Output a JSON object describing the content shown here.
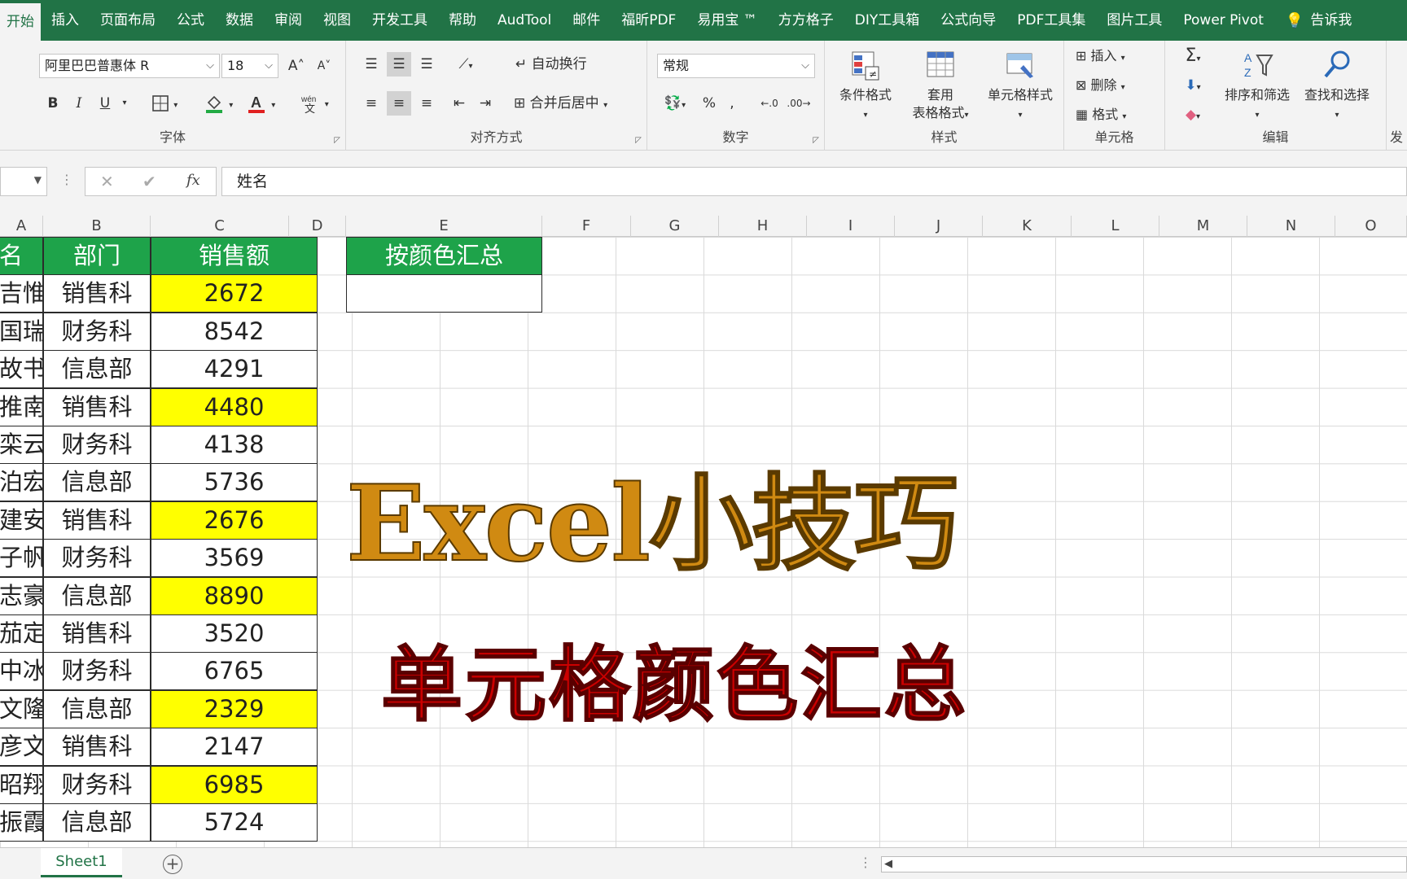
{
  "ribbon_tabs": [
    "开始",
    "插入",
    "页面布局",
    "公式",
    "数据",
    "审阅",
    "视图",
    "开发工具",
    "帮助",
    "AudTool",
    "邮件",
    "福昕PDF",
    "易用宝 ™",
    "方方格子",
    "DIY工具箱",
    "公式向导",
    "PDF工具集",
    "图片工具",
    "Power Pivot"
  ],
  "tell_me": "告诉我",
  "font": {
    "name": "阿里巴巴普惠体 R",
    "size": "18",
    "bold": "B",
    "italic": "I",
    "underline": "U",
    "grow": "A˄",
    "shrink": "A˅",
    "label": "字体"
  },
  "alignment": {
    "wrap": "自动换行",
    "merge": "合并后居中",
    "label": "对齐方式"
  },
  "number": {
    "format": "常规",
    "percent": "%",
    "comma": ",",
    "label": "数字"
  },
  "styles": {
    "conditional": "条件格式",
    "table_1": "套用",
    "table_2": "表格格式",
    "cell_styles": "单元格样式",
    "label": "样式"
  },
  "cells": {
    "insert": "插入",
    "delete": "删除",
    "format": "格式",
    "label": "单元格"
  },
  "editing": {
    "sort": "排序和筛选",
    "find": "查找和选择",
    "label": "编辑",
    "cut_label": "发"
  },
  "formula_bar": {
    "value": "姓名",
    "fx": "fx"
  },
  "columns": [
    "A",
    "B",
    "C",
    "D",
    "E",
    "F",
    "G",
    "H",
    "I",
    "J",
    "K",
    "L",
    "M",
    "N",
    "O"
  ],
  "table": {
    "headers": [
      "名",
      "部门",
      "销售额"
    ],
    "rows": [
      {
        "name": "吉惟",
        "dept": "销售科",
        "sales": "2672",
        "highlight": true
      },
      {
        "name": "国瑞",
        "dept": "财务科",
        "sales": "8542",
        "highlight": false
      },
      {
        "name": "故书",
        "dept": "信息部",
        "sales": "4291",
        "highlight": false
      },
      {
        "name": "推南",
        "dept": "销售科",
        "sales": "4480",
        "highlight": true
      },
      {
        "name": "栾云",
        "dept": "财务科",
        "sales": "4138",
        "highlight": false
      },
      {
        "name": "泊宏",
        "dept": "信息部",
        "sales": "5736",
        "highlight": false
      },
      {
        "name": "建安",
        "dept": "销售科",
        "sales": "2676",
        "highlight": true
      },
      {
        "name": "子帆",
        "dept": "财务科",
        "sales": "3569",
        "highlight": false
      },
      {
        "name": "志豪",
        "dept": "信息部",
        "sales": "8890",
        "highlight": true
      },
      {
        "name": "茄定",
        "dept": "销售科",
        "sales": "3520",
        "highlight": false
      },
      {
        "name": "中冰",
        "dept": "财务科",
        "sales": "6765",
        "highlight": false
      },
      {
        "name": "文隆",
        "dept": "信息部",
        "sales": "2329",
        "highlight": true
      },
      {
        "name": "彦文",
        "dept": "销售科",
        "sales": "2147",
        "highlight": false
      },
      {
        "name": "昭翔",
        "dept": "财务科",
        "sales": "6985",
        "highlight": true
      },
      {
        "name": "振霞",
        "dept": "信息部",
        "sales": "5724",
        "highlight": false
      }
    ]
  },
  "summary_header": "按颜色汇总",
  "overlay": {
    "title": "Excel小技巧",
    "subtitle": "单元格颜色汇总"
  },
  "sheet_tab": "Sheet1",
  "colors": {
    "ribbon": "#217346",
    "header_green": "#1ea34a",
    "highlight": "#ffff00",
    "title": "#d08a12",
    "subtitle": "#cc0000"
  }
}
